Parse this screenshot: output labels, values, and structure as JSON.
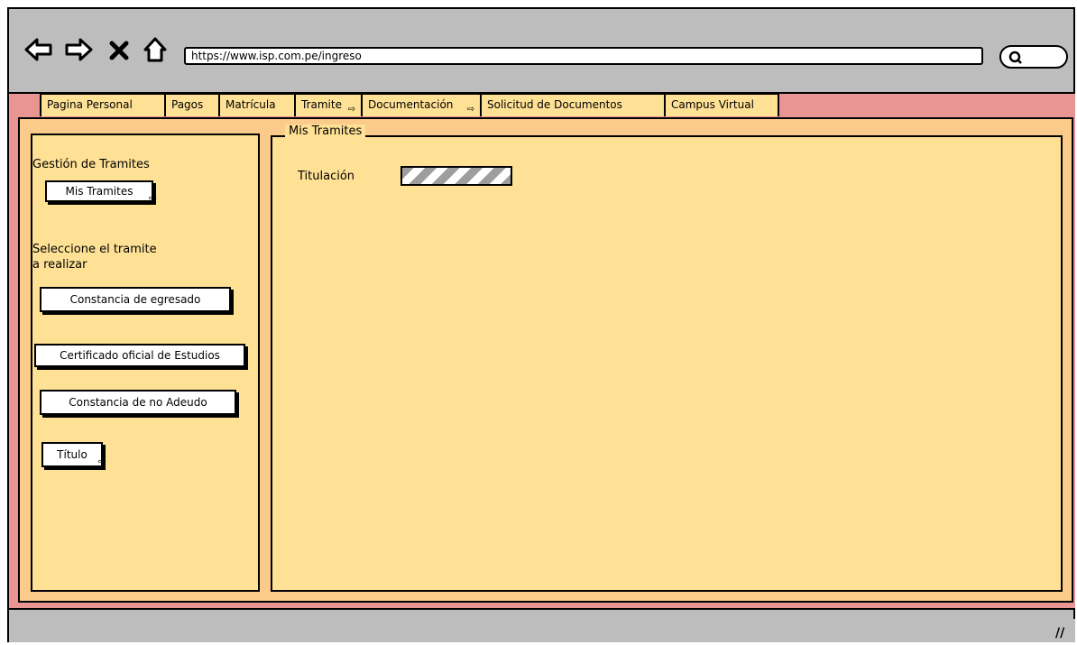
{
  "browser": {
    "url": "https://www.isp.com.pe/ingreso",
    "back_icon": "arrow-left-icon",
    "forward_icon": "arrow-right-icon",
    "stop_icon": "close-icon",
    "home_icon": "home-icon",
    "search_icon": "search-icon"
  },
  "tabs": [
    {
      "label": "Pagina Personal"
    },
    {
      "label": "Pagos"
    },
    {
      "label": "Matrícula"
    },
    {
      "label": "Tramite"
    },
    {
      "label": "Documentación"
    },
    {
      "label": "Solicitud de Documentos"
    },
    {
      "label": "Campus Virtual"
    }
  ],
  "sidebar": {
    "section_title": "Gestión de Tramites",
    "mis_tramites_button": "Mis Tramites",
    "prompt_line1": "Seleccione el tramite",
    "prompt_line2": "a realizar",
    "buttons": [
      {
        "label": "Constancia de egresado"
      },
      {
        "label": "Certificado oficial de Estudios"
      },
      {
        "label": "Constancia de no Adeudo"
      },
      {
        "label": "Título"
      }
    ]
  },
  "main": {
    "group_title": "Mis Tramites",
    "rows": [
      {
        "label": "Titulación",
        "progress": 0.5
      }
    ]
  },
  "colors": {
    "tab_strip": "#e99594",
    "content_bg": "#fbcb8c",
    "panel_bg": "#ffe196",
    "chrome": "#bdbdbd"
  }
}
